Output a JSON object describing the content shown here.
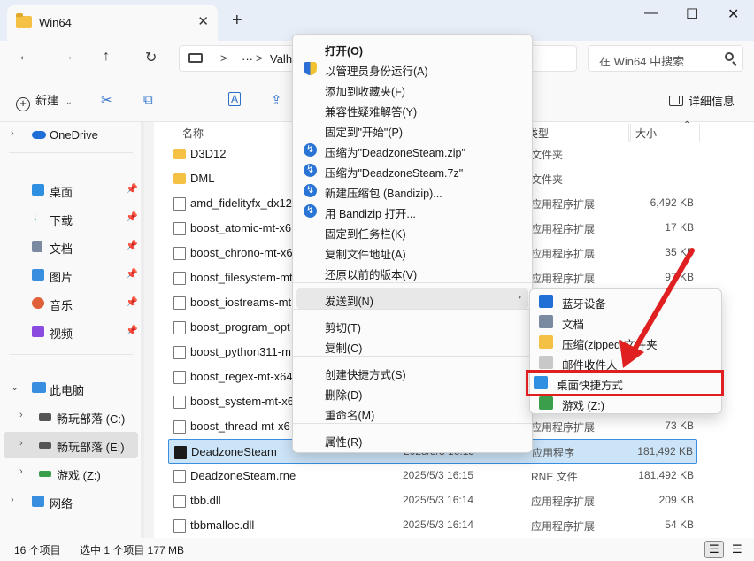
{
  "window": {
    "tab_title": "Win64",
    "new_tab": "+",
    "close_tab": "✕",
    "minimize": "—",
    "maximize": "☐",
    "close": "✕"
  },
  "address": {
    "back": "←",
    "forward": "→",
    "up": "↑",
    "refresh": "↻",
    "sep1": ">",
    "ellipsis": "···",
    "sep2": ">",
    "crumb_partial": "Valh",
    "search_placeholder": "在 Win64 中搜索"
  },
  "toolbar": {
    "new_label": "新建",
    "new_dropdown": "⌄",
    "cut": "✂",
    "copy": "⧉",
    "rename": "A",
    "share": "⇪",
    "details_label": "详细信息"
  },
  "sidebar": {
    "onedrive": "OneDrive",
    "quick": [
      {
        "label": "桌面",
        "icon": "desktop-icon",
        "color": "#2f8fe0"
      },
      {
        "label": "下载",
        "icon": "download-icon",
        "color": "#2e9e5a"
      },
      {
        "label": "文档",
        "icon": "document-icon",
        "color": "#7a8aa0"
      },
      {
        "label": "图片",
        "icon": "picture-icon",
        "color": "#3a8ee0"
      },
      {
        "label": "音乐",
        "icon": "music-icon",
        "color": "#e0603a"
      },
      {
        "label": "视频",
        "icon": "video-icon",
        "color": "#8a4ae0"
      }
    ],
    "pin": "📌",
    "this_pc": "此电脑",
    "drives": [
      {
        "label": "畅玩部落 (C:)",
        "icon": "windows-drive-icon"
      },
      {
        "label": "畅玩部落 (E:)",
        "icon": "drive-icon"
      },
      {
        "label": "游戏 (Z:)",
        "icon": "drive-icon"
      }
    ],
    "network": "网络",
    "chev_right": "›",
    "chev_down": "⌄"
  },
  "columns": {
    "name": "名称",
    "type": "类型",
    "size": "大小",
    "sort": "⌃"
  },
  "files": [
    {
      "name": "D3D12",
      "date": "",
      "type": "文件夹",
      "size": "",
      "kind": "folder"
    },
    {
      "name": "DML",
      "date": "",
      "type": "文件夹",
      "size": "",
      "kind": "folder"
    },
    {
      "name": "amd_fidelityfx_dx12.",
      "date": "",
      "type": "应用程序扩展",
      "size": "6,492 KB",
      "kind": "doc"
    },
    {
      "name": "boost_atomic-mt-x6",
      "date": "",
      "type": "应用程序扩展",
      "size": "17 KB",
      "kind": "doc"
    },
    {
      "name": "boost_chrono-mt-x6",
      "date": "",
      "type": "应用程序扩展",
      "size": "35 KB",
      "kind": "doc"
    },
    {
      "name": "boost_filesystem-mt",
      "date": "",
      "type": "应用程序扩展",
      "size": "97 KB",
      "kind": "doc"
    },
    {
      "name": "boost_iostreams-mt",
      "date": "",
      "type": "",
      "size": "",
      "kind": "doc"
    },
    {
      "name": "boost_program_opt",
      "date": "",
      "type": "",
      "size": "",
      "kind": "doc"
    },
    {
      "name": "boost_python311-m",
      "date": "",
      "type": "",
      "size": "",
      "kind": "doc"
    },
    {
      "name": "boost_regex-mt-x64",
      "date": "",
      "type": "",
      "size": "",
      "kind": "doc"
    },
    {
      "name": "boost_system-mt-x6",
      "date": "",
      "type": "",
      "size": "",
      "kind": "doc"
    },
    {
      "name": "boost_thread-mt-x6",
      "date": "",
      "type": "应用程序扩展",
      "size": "73 KB",
      "kind": "doc"
    },
    {
      "name": "DeadzoneSteam",
      "date": "2025/5/3 16:15",
      "type": "应用程序",
      "size": "181,492 KB",
      "kind": "exe"
    },
    {
      "name": "DeadzoneSteam.rne",
      "date": "2025/5/3 16:15",
      "type": "RNE 文件",
      "size": "181,492 KB",
      "kind": "doc"
    },
    {
      "name": "tbb.dll",
      "date": "2025/5/3 16:14",
      "type": "应用程序扩展",
      "size": "209 KB",
      "kind": "doc"
    },
    {
      "name": "tbbmalloc.dll",
      "date": "2025/5/3 16:14",
      "type": "应用程序扩展",
      "size": "54 KB",
      "kind": "doc"
    }
  ],
  "status": {
    "count": "16 个项目",
    "selected": "选中 1 个项目  177 MB"
  },
  "context_menu": {
    "items": [
      {
        "label": "打开(O)",
        "icon": "",
        "bold": true
      },
      {
        "label": "以管理员身份运行(A)",
        "icon": "shield"
      },
      {
        "label": "添加到收藏夹(F)",
        "icon": ""
      },
      {
        "label": "兼容性疑难解答(Y)",
        "icon": ""
      },
      {
        "label": "固定到\"开始\"(P)",
        "icon": ""
      },
      {
        "label": "压缩为\"DeadzoneSteam.zip\"",
        "icon": "bz"
      },
      {
        "label": "压缩为\"DeadzoneSteam.7z\"",
        "icon": "bz"
      },
      {
        "label": "新建压缩包 (Bandizip)...",
        "icon": "bz"
      },
      {
        "label": "用 Bandizip 打开...",
        "icon": "bz"
      },
      {
        "label": "固定到任务栏(K)",
        "icon": ""
      },
      {
        "label": "复制文件地址(A)",
        "icon": ""
      },
      {
        "label": "还原以前的版本(V)",
        "icon": ""
      },
      {
        "label": "发送到(N)",
        "icon": "",
        "submenu": true
      },
      {
        "label": "剪切(T)",
        "icon": ""
      },
      {
        "label": "复制(C)",
        "icon": ""
      },
      {
        "label": "创建快捷方式(S)",
        "icon": ""
      },
      {
        "label": "删除(D)",
        "icon": ""
      },
      {
        "label": "重命名(M)",
        "icon": ""
      },
      {
        "label": "属性(R)",
        "icon": ""
      }
    ],
    "submenu_arrow": "›"
  },
  "send_to": [
    {
      "label": "蓝牙设备",
      "icon": "bluetooth-icon",
      "color": "#1f6fd6"
    },
    {
      "label": "文档",
      "icon": "document-icon",
      "color": "#7a8aa0"
    },
    {
      "label": "压缩(zipped)文件夹",
      "icon": "zip-folder-icon",
      "color": "#f5c144"
    },
    {
      "label": "邮件收件人",
      "icon": "mail-icon",
      "color": "#c8c8c8"
    },
    {
      "label": "桌面快捷方式",
      "icon": "desktop-icon",
      "color": "#2f8fe0"
    },
    {
      "label": "游戏 (Z:)",
      "icon": "drive-icon",
      "color": "#3a9e4a"
    }
  ],
  "annotation_color": "#e02020"
}
